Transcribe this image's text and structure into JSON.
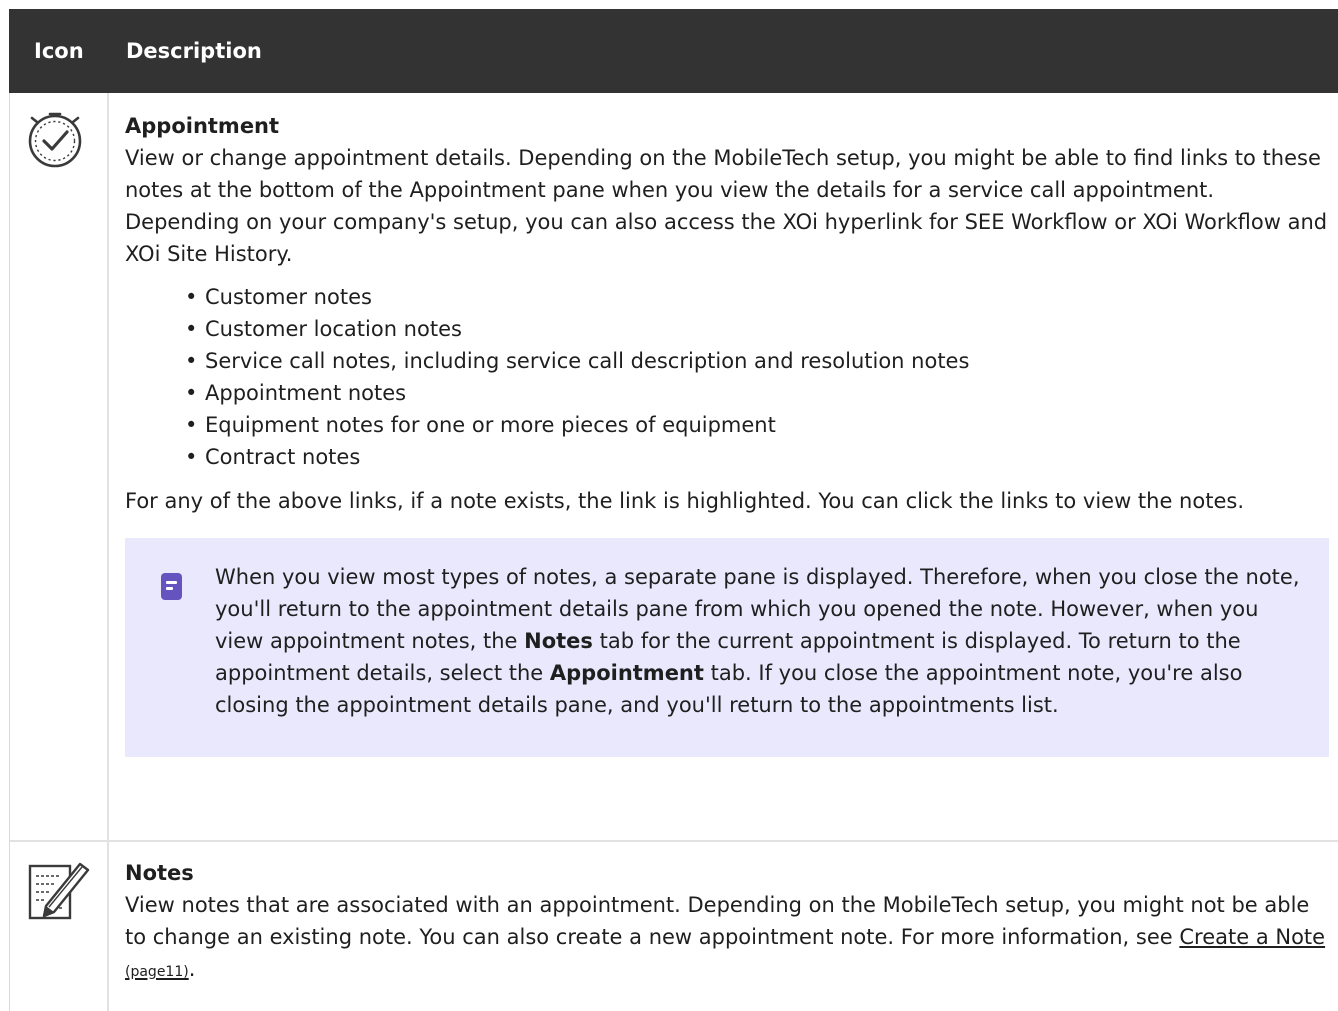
{
  "header": {
    "icon_label": "Icon",
    "description_label": "Description"
  },
  "rows": [
    {
      "icon": "appointment-clock-check-icon",
      "title": "Appointment",
      "description": "View or change appointment details. Depending on the MobileTech setup, you might be able to find links to these notes at the bottom of the Appointment pane when you view the details for a service call appointment. Depending on your company's setup, you can also access the XOi hyperlink for SEE Workflow or XOi Workflow and XOi Site History.",
      "bullets": [
        "Customer notes",
        "Customer location notes",
        "Service call notes, including service call description and resolution notes",
        "Appointment notes",
        "Equipment notes for one or more pieces of equipment",
        "Contract notes"
      ],
      "after_list": "For any of the above links, if a note exists, the link is highlighted. You can click the links to view the notes.",
      "note": {
        "icon": "note-icon",
        "part1": "When you view most types of notes, a separate pane is displayed. Therefore, when you close the note, you'll return to the appointment details pane from which you opened the note. However, when you view appointment notes, the ",
        "bold1": "Notes",
        "part2": " tab for the current appointment is displayed. To return to the appointment details, select the ",
        "bold2": "Appointment",
        "part3": " tab. If you close the appointment note, you're also closing the appointment details pane, and you'll return to the appointments list."
      }
    },
    {
      "icon": "notes-pencil-icon",
      "title": "Notes",
      "description": "View notes that are associated with an appointment. Depending on the MobileTech setup, you might not be able to change an existing note. You can also create a new appointment note. For more information, see ",
      "link_text": "Create a Note",
      "link_page": "(page11)",
      "description_end": "."
    }
  ]
}
